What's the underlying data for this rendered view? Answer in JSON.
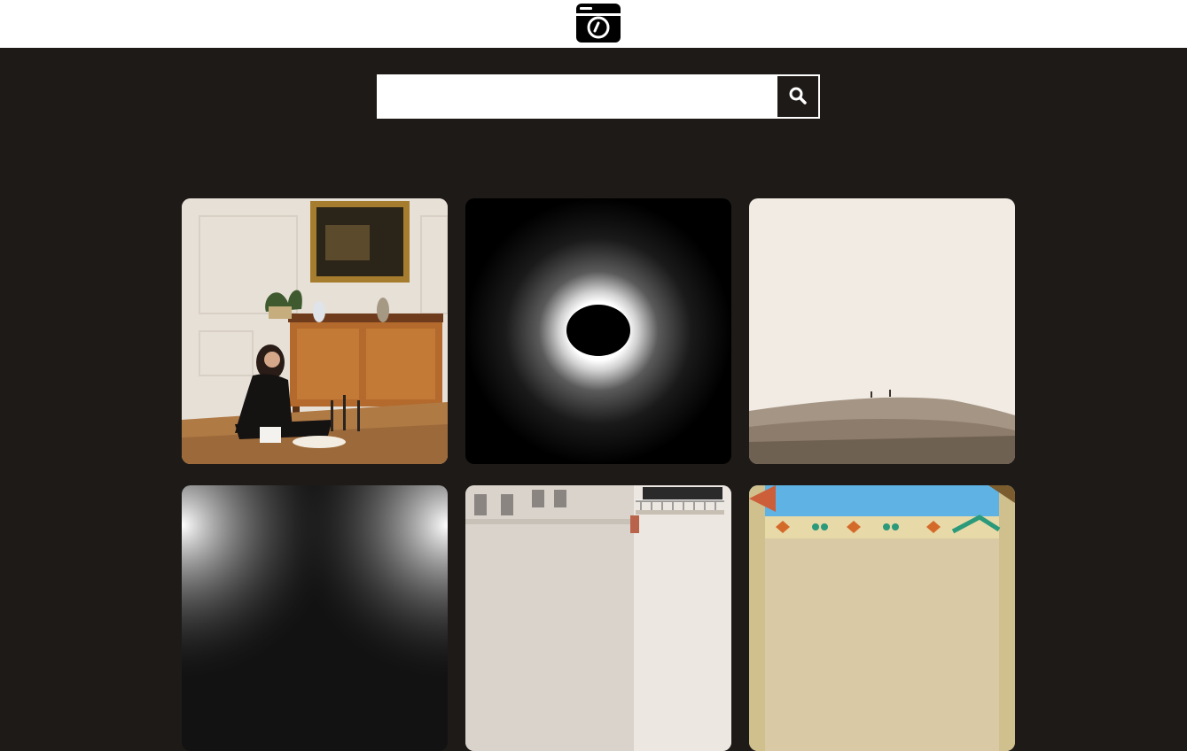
{
  "header": {
    "logo_icon": "camera-icon"
  },
  "search": {
    "value": "",
    "placeholder": "",
    "button_icon": "search-icon"
  },
  "colors": {
    "background": "#1e1a17",
    "header_bg": "#ffffff"
  },
  "gallery": {
    "photos": [
      {
        "subject": "woman-sitting-by-sideboard"
      },
      {
        "subject": "solar-eclipse"
      },
      {
        "subject": "desert-dunes"
      },
      {
        "subject": "dark-gradient"
      },
      {
        "subject": "apartment-building"
      },
      {
        "subject": "ornate-tiled-facade"
      }
    ]
  }
}
